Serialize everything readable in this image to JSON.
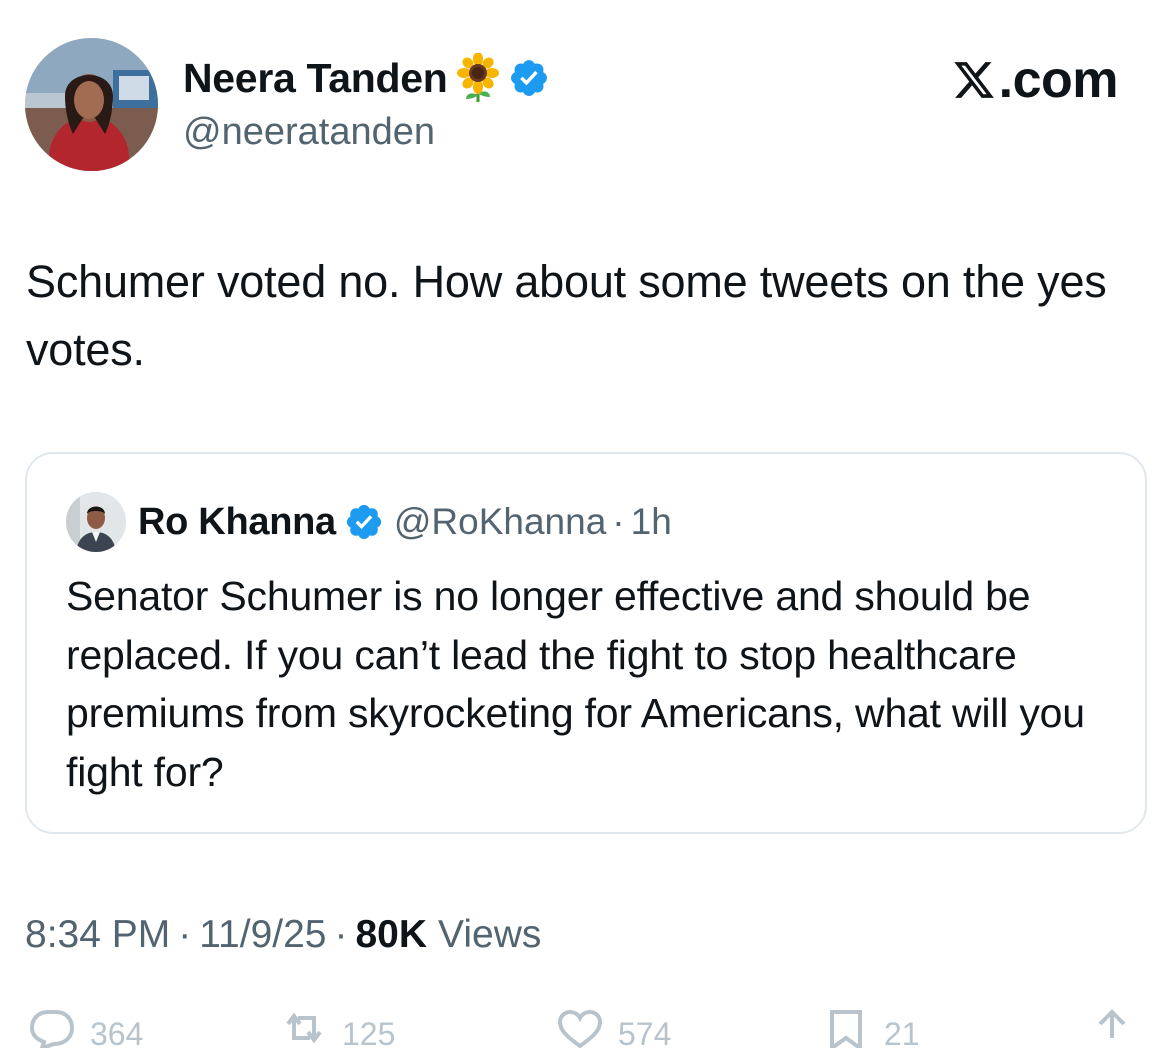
{
  "author": {
    "name": "Neera Tanden",
    "emoji_icon": "sunflower-icon",
    "verified_icon": "verified-badge-icon",
    "handle": "@neeratanden"
  },
  "brand": {
    "logo_icon": "x-logo-icon",
    "text": ".com"
  },
  "tweet": {
    "text": "Schumer voted no. How about some tweets on the yes votes."
  },
  "quoted_tweet": {
    "name": "Ro Khanna",
    "verified_icon": "verified-badge-icon",
    "handle": "@RoKhanna",
    "separator": "·",
    "time": "1h",
    "text": "Senator Schumer is no longer effective and should be replaced. If you can’t lead the fight to stop healthcare premiums from skyrocketing for Americans, what will you fight for?"
  },
  "meta": {
    "time": "8:34 PM",
    "separator": "·",
    "date": "11/9/25",
    "views_count": "80K",
    "views_label": "Views"
  },
  "actions": {
    "reply": {
      "icon": "reply-icon",
      "count": "364"
    },
    "repost": {
      "icon": "repost-icon",
      "count": "125"
    },
    "like": {
      "icon": "heart-icon",
      "count": "574"
    },
    "bookmark": {
      "icon": "bookmark-icon",
      "count": "21"
    },
    "share": {
      "icon": "share-icon"
    }
  },
  "colors": {
    "text_primary": "#0f1419",
    "text_secondary": "#536471",
    "verified_blue": "#1d9bf0",
    "border": "#e1e8ed"
  }
}
